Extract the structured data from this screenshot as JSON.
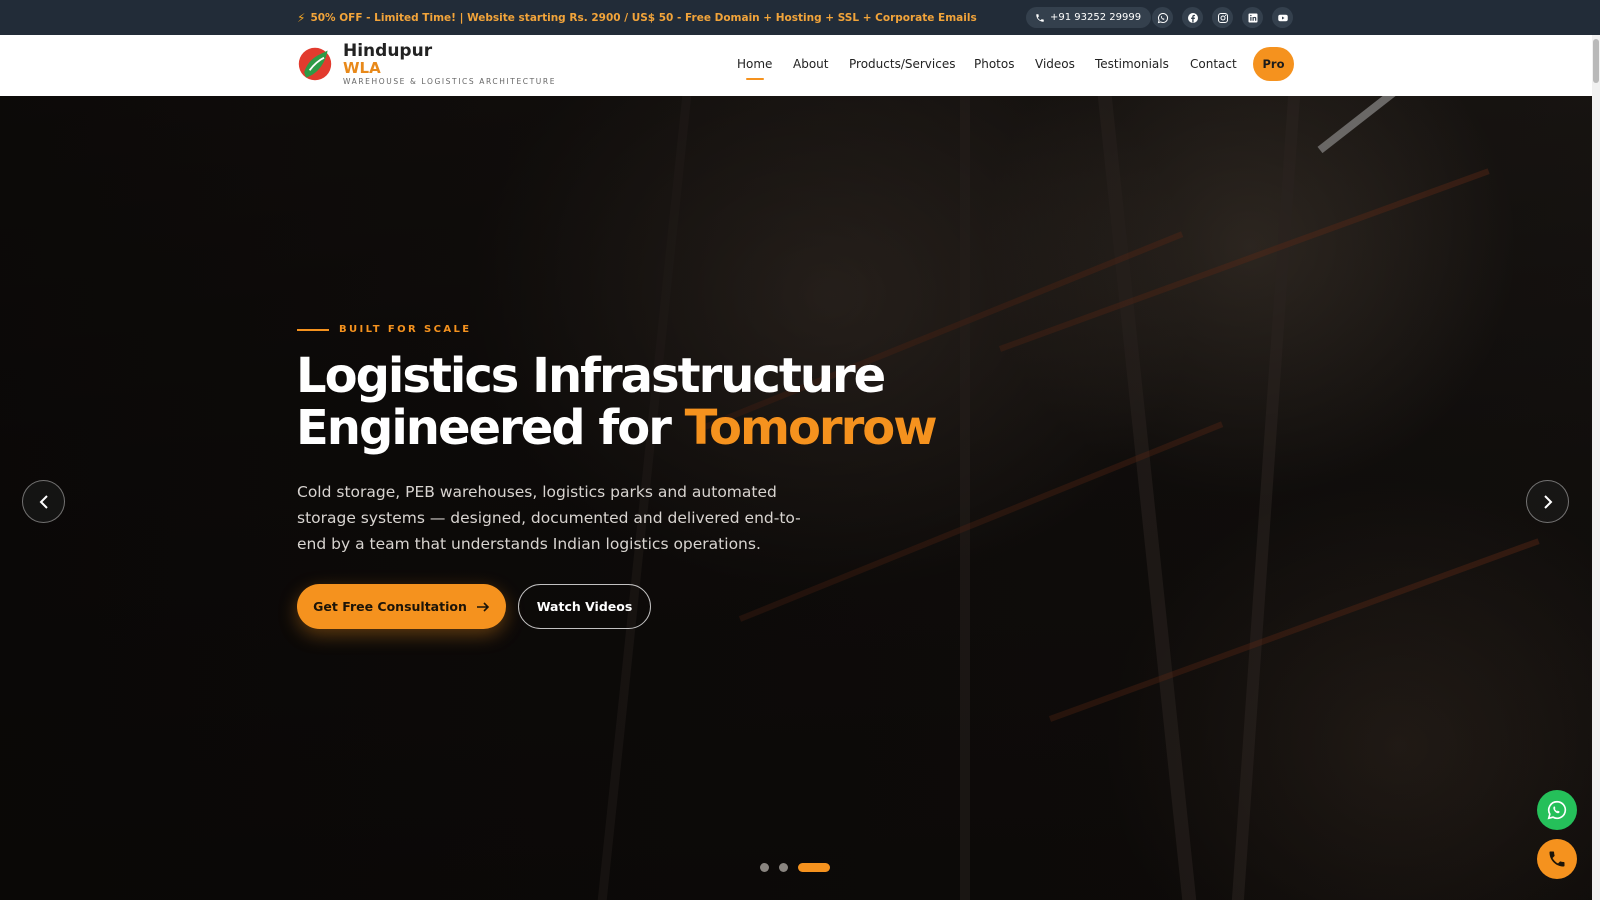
{
  "topbar": {
    "promo_text": "50% OFF - Limited Time! | Website starting Rs. 2900 / US$ 50 - Free Domain + Hosting + SSL + Corporate Emails",
    "phone": "+91 93252 29999",
    "socials": [
      "whatsapp-icon",
      "facebook-icon",
      "instagram-icon",
      "linkedin-icon",
      "youtube-icon"
    ]
  },
  "brand": {
    "name": "Hindupur",
    "wla": "WLA",
    "tagline": "WAREHOUSE & LOGISTICS ARCHITECTURE"
  },
  "nav": {
    "items": [
      {
        "label": "Home",
        "active": true
      },
      {
        "label": "About",
        "active": false
      },
      {
        "label": "Products/Services",
        "active": false
      },
      {
        "label": "Photos",
        "active": false
      },
      {
        "label": "Videos",
        "active": false
      },
      {
        "label": "Testimonials",
        "active": false
      },
      {
        "label": "Contact",
        "active": false
      }
    ],
    "pro_label": "Pro"
  },
  "hero": {
    "eyebrow": "BUILT FOR SCALE",
    "headline_line1": "Logistics Infrastructure",
    "headline_line2_prefix": "Engineered for ",
    "headline_accent": "Tomorrow",
    "subtext": "Cold storage, PEB warehouses, logistics parks and automated storage systems — designed, documented and delivered end-to-end by a team that understands Indian logistics operations.",
    "primary_cta": "Get Free Consultation",
    "secondary_cta": "Watch Videos",
    "slides_total": 3,
    "active_slide": 3
  },
  "colors": {
    "accent": "#f5921e",
    "topbar_bg": "#222c38",
    "whatsapp": "#25c05a"
  }
}
